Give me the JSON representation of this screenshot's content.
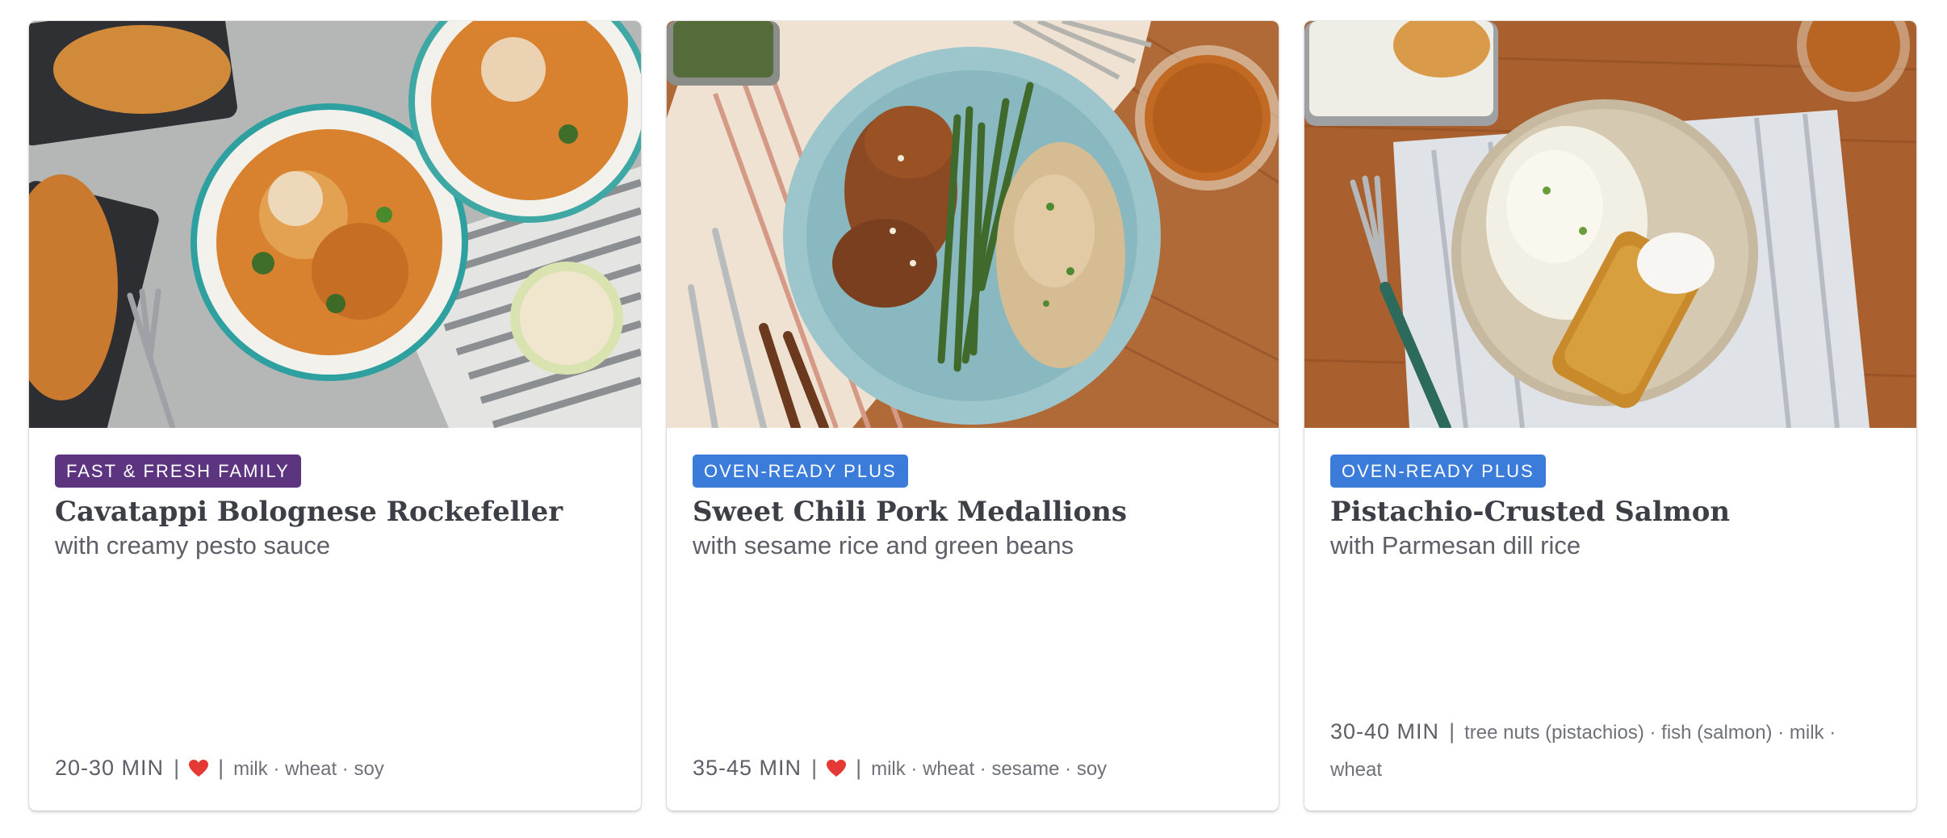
{
  "cards": [
    {
      "tag": "FAST & FRESH FAMILY",
      "tag_color": "#5c3480",
      "title": "Cavatappi Bolognese Rockefeller",
      "subtitle": "with creamy pesto sauce",
      "time": "20-30 MIN",
      "heart_icon": "heart-icon",
      "allergens": "milk · wheat · soy"
    },
    {
      "tag": "OVEN-READY PLUS",
      "tag_color": "#3b7bd9",
      "title": "Sweet Chili Pork Medallions",
      "subtitle": "with sesame rice and green beans",
      "time": "35-45 MIN",
      "heart_icon": "heart-icon",
      "allergens": "milk · wheat · sesame · soy"
    },
    {
      "tag": "OVEN-READY PLUS",
      "tag_color": "#3b7bd9",
      "title": "Pistachio-Crusted Salmon",
      "subtitle": "with Parmesan dill rice",
      "time": "30-40 MIN",
      "allergens": "tree nuts (pistachios) · fish (salmon) · milk ·",
      "allergens_cont": "wheat"
    }
  ],
  "separator": "|",
  "colors": {
    "heart": "#e53935"
  }
}
